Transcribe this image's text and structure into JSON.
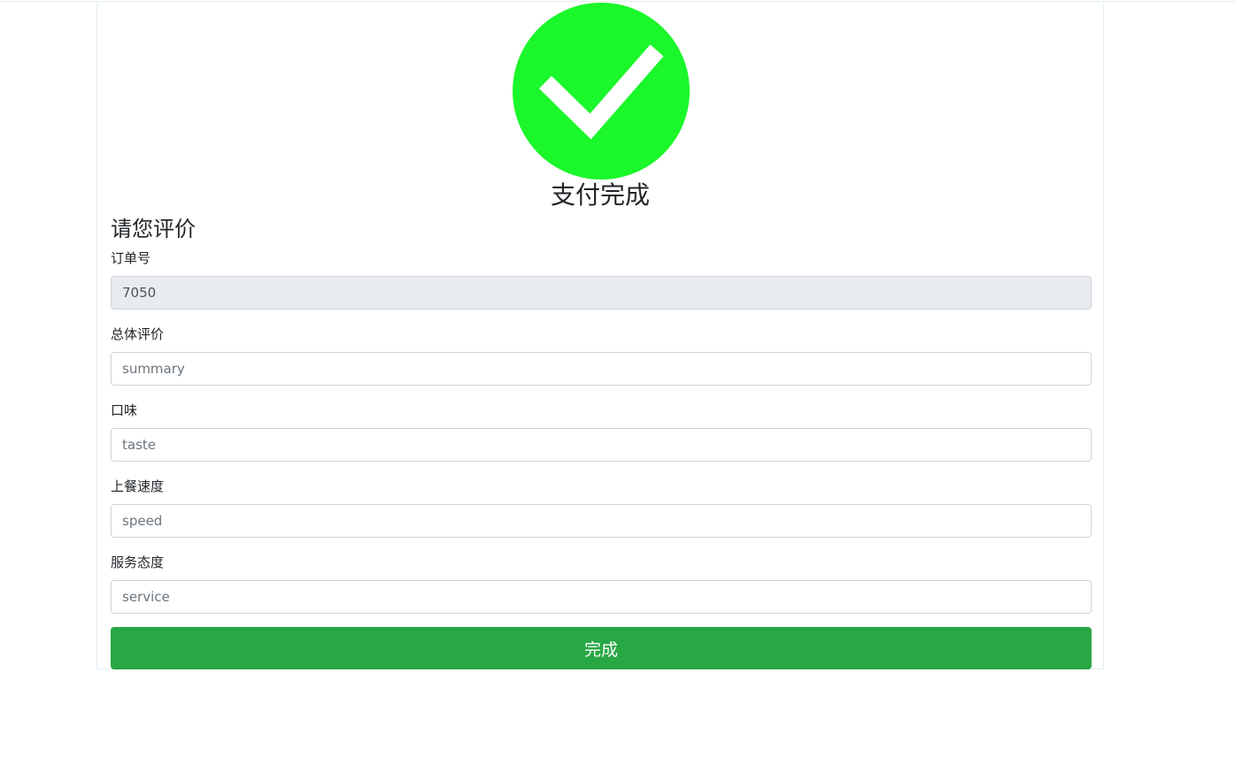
{
  "header": {
    "status_icon": "success-check-icon",
    "status_title": "支付完成"
  },
  "review": {
    "heading": "请您评价",
    "order": {
      "label": "订单号",
      "value": "7050"
    },
    "summary": {
      "label": "总体评价",
      "placeholder": "summary"
    },
    "taste": {
      "label": "口味",
      "placeholder": "taste"
    },
    "speed": {
      "label": "上餐速度",
      "placeholder": "speed"
    },
    "service": {
      "label": "服务态度",
      "placeholder": "service"
    },
    "submit_label": "完成"
  },
  "colors": {
    "success_icon": "#1af72a",
    "submit_button": "#28a745",
    "readonly_input": "#e9ecef"
  }
}
